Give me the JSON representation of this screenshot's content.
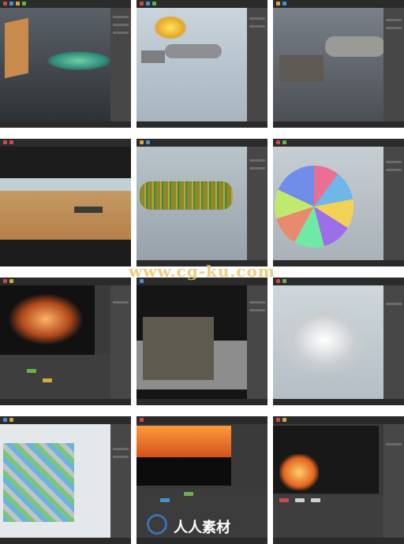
{
  "watermark": {
    "text": "www.cg-ku.com"
  },
  "logo": {
    "text": "人人素材"
  },
  "tiles": [
    {
      "id": "tile-1",
      "scene": "particle-scatter"
    },
    {
      "id": "tile-2",
      "scene": "tanker-explosion-preview"
    },
    {
      "id": "tile-3",
      "scene": "tanker-truck-spiked"
    },
    {
      "id": "tile-4",
      "scene": "desert-landscape"
    },
    {
      "id": "tile-5",
      "scene": "tanker-wireframe-fracture"
    },
    {
      "id": "tile-6",
      "scene": "voronoi-sphere"
    },
    {
      "id": "tile-7",
      "scene": "explosion-burst"
    },
    {
      "id": "tile-8",
      "scene": "truck-render"
    },
    {
      "id": "tile-9",
      "scene": "debris-burst"
    },
    {
      "id": "tile-10",
      "scene": "fractured-tanker-colored"
    },
    {
      "id": "tile-11",
      "scene": "fire-compositing"
    },
    {
      "id": "tile-12",
      "scene": "small-fire-nodes"
    }
  ]
}
